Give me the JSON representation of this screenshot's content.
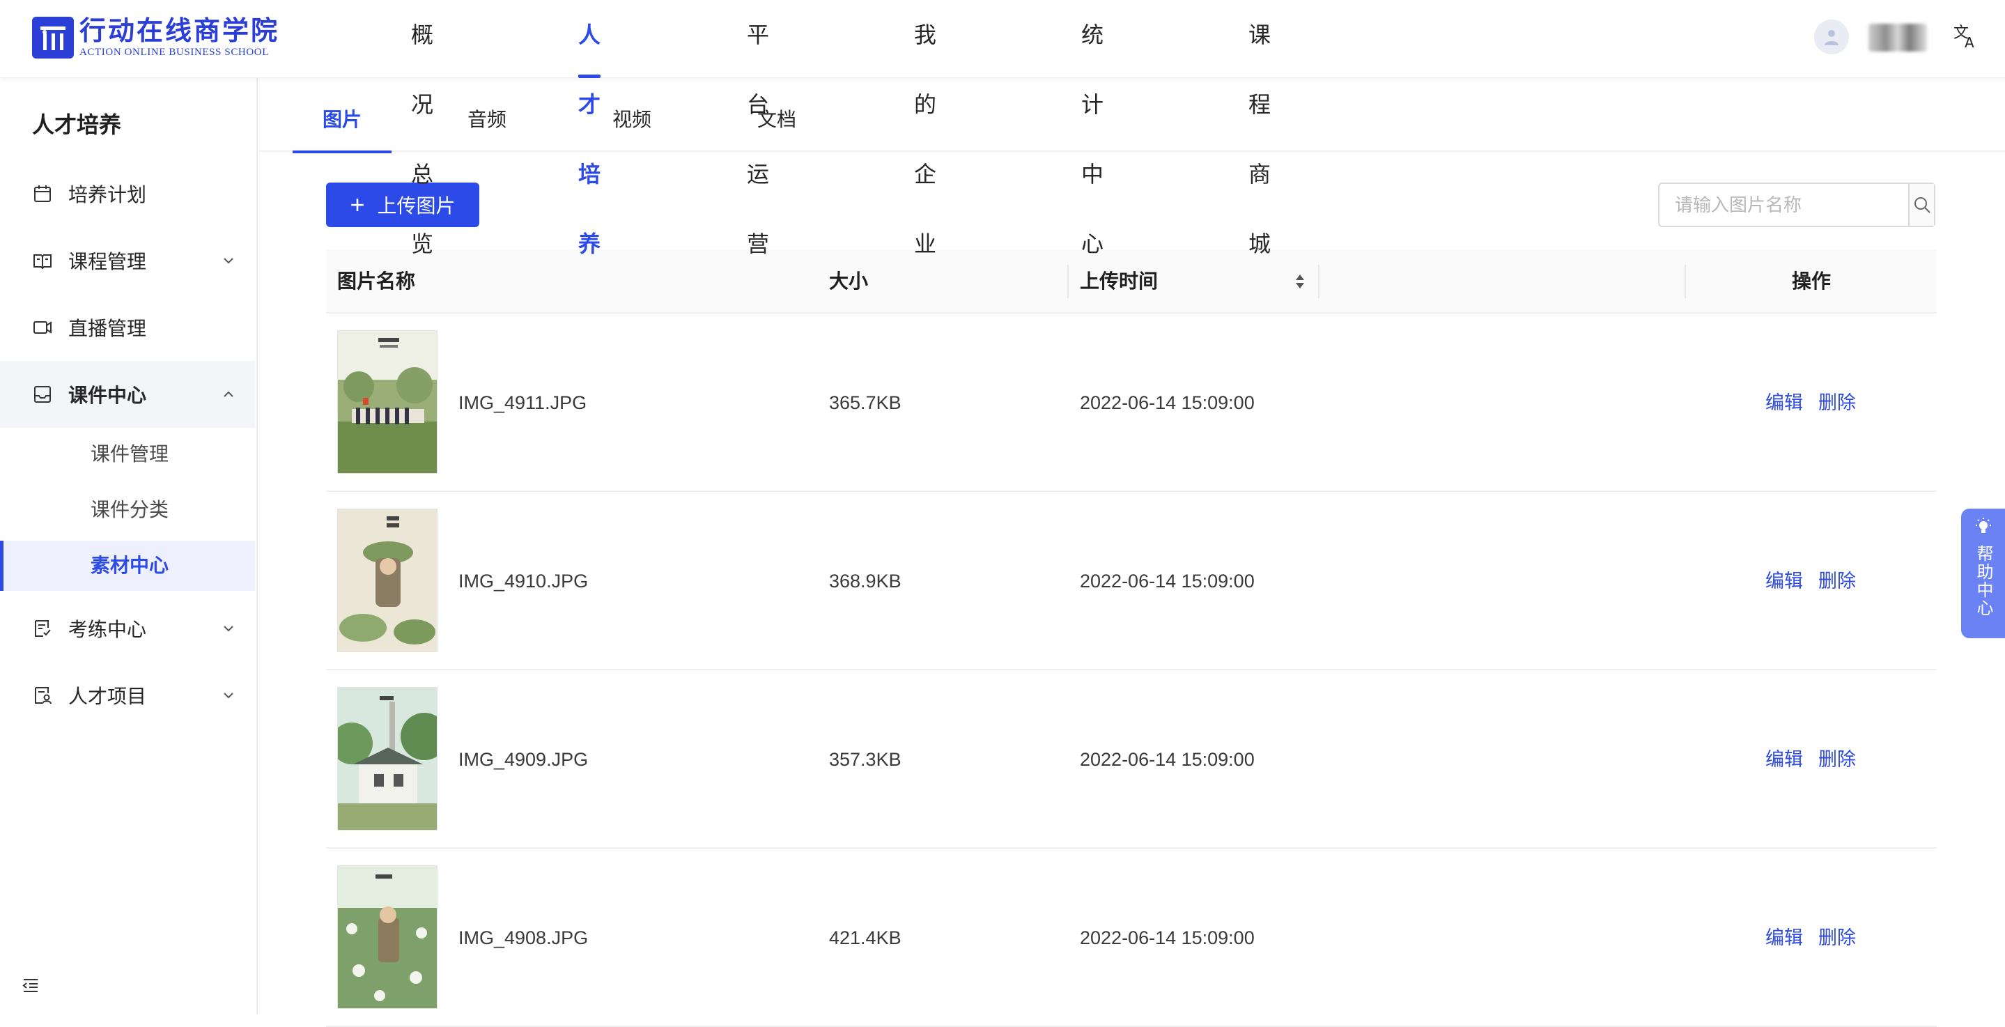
{
  "brand": {
    "name_cn": "行动在线商学院",
    "name_en": "ACTION ONLINE BUSINESS SCHOOL",
    "color": "#2b3fd6"
  },
  "topnav": {
    "items": [
      "概况总览",
      "人才培养",
      "平台运营",
      "我的企业",
      "统计中心",
      "课程商城"
    ],
    "active": "人才培养",
    "accent": "#2b4ae8"
  },
  "header": {
    "avatar_icon": "user-avatar-icon",
    "lang_icon": "translate-icon"
  },
  "sidebar": {
    "title": "人才培养",
    "items": [
      {
        "label": "培养计划",
        "icon": "calendar-icon"
      },
      {
        "label": "课程管理",
        "icon": "book-icon"
      },
      {
        "label": "直播管理",
        "icon": "video-camera-icon"
      },
      {
        "label": "课件中心",
        "icon": "inbox-icon"
      },
      {
        "label": "考练中心",
        "icon": "exam-icon"
      },
      {
        "label": "人才项目",
        "icon": "talent-icon"
      }
    ],
    "sub_items": [
      "课件管理",
      "课件分类",
      "素材中心"
    ],
    "active_sub": "素材中心"
  },
  "tabs": {
    "items": [
      "图片",
      "音频",
      "视频",
      "文档"
    ],
    "active": "图片"
  },
  "toolbar": {
    "upload_label": "上传图片",
    "search_placeholder": "请输入图片名称"
  },
  "table": {
    "headers": {
      "name": "图片名称",
      "size": "大小",
      "time": "上传时间",
      "actions": "操作"
    },
    "rows": [
      {
        "name": "IMG_4911.JPG",
        "size": "365.7KB",
        "time": "2022-06-14 15:09:00",
        "edit": "编辑",
        "delete": "删除"
      },
      {
        "name": "IMG_4910.JPG",
        "size": "368.9KB",
        "time": "2022-06-14 15:09:00",
        "edit": "编辑",
        "delete": "删除"
      },
      {
        "name": "IMG_4909.JPG",
        "size": "357.3KB",
        "time": "2022-06-14 15:09:00",
        "edit": "编辑",
        "delete": "删除"
      },
      {
        "name": "IMG_4908.JPG",
        "size": "421.4KB",
        "time": "2022-06-14 15:09:00",
        "edit": "编辑",
        "delete": "删除"
      }
    ]
  },
  "help": {
    "label": "帮助中心"
  }
}
